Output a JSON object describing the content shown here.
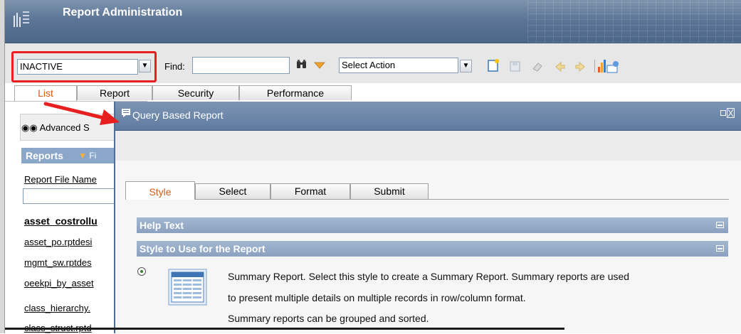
{
  "app": {
    "title": "Report Administration"
  },
  "toolbar": {
    "filter_value": "INACTIVE",
    "find_label": "Find:",
    "find_value": "",
    "action_value": "Select Action"
  },
  "main_tabs": [
    "List",
    "Report",
    "Security",
    "Performance"
  ],
  "left_panel": {
    "advanced_search": "Advanced S",
    "reports_label": "Reports",
    "reports_filter": "Fi",
    "report_file_name_label": "Report File Name",
    "report_links": [
      "asset_costrollu",
      "asset_po.rptdesi",
      "mgmt_sw.rptdes",
      "oeekpi_by_asset",
      "class_hierarchy.",
      "class_struct.rptd"
    ]
  },
  "dialog": {
    "title": "Query Based Report",
    "tabs": [
      "Style",
      "Select",
      "Format",
      "Submit"
    ],
    "sections": {
      "help_text": "Help Text",
      "style_to_use": "Style to Use for the Report"
    },
    "summary_description": [
      "Summary Report. Select this style to create a Summary Report. Summary reports are used",
      "to present multiple details on multiple records in row/column format.",
      "Summary reports can be grouped and sorted."
    ]
  },
  "colors": {
    "highlight": "#e81f1f",
    "accent_tab": "#d85a12",
    "header": "#5d7697"
  }
}
